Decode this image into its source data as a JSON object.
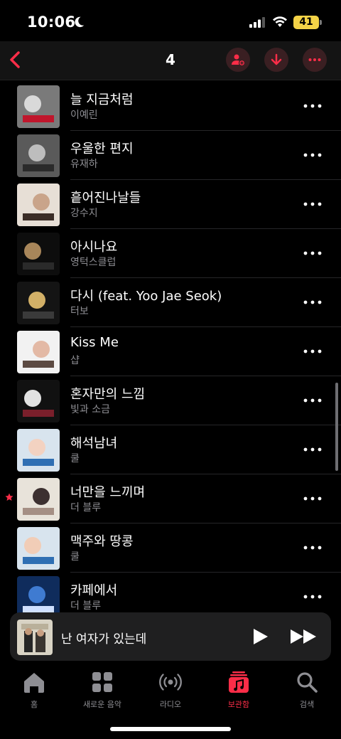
{
  "status_bar": {
    "time": "10:06",
    "battery": "41"
  },
  "nav": {
    "title": "4"
  },
  "songs": [
    {
      "title": "늘 지금처럼",
      "artist": "이예린",
      "favorite": false
    },
    {
      "title": "우울한 편지",
      "artist": "유재하",
      "favorite": false
    },
    {
      "title": "흩어진나날들",
      "artist": "강수지",
      "favorite": false
    },
    {
      "title": "아시나요",
      "artist": "영턱스클럽",
      "favorite": false
    },
    {
      "title": "다시 (feat. Yoo Jae Seok)",
      "artist": "터보",
      "favorite": false
    },
    {
      "title": "Kiss Me",
      "artist": "샵",
      "favorite": false
    },
    {
      "title": "혼자만의 느낌",
      "artist": "빛과 소금",
      "favorite": false
    },
    {
      "title": "해석남녀",
      "artist": "쿨",
      "favorite": false
    },
    {
      "title": "너만을 느끼며",
      "artist": "더 블루",
      "favorite": true
    },
    {
      "title": "맥주와 땅콩",
      "artist": "쿨",
      "favorite": false
    },
    {
      "title": "카페에서",
      "artist": "더 블루",
      "favorite": false
    }
  ],
  "now_playing": {
    "title": "난 여자가 있는데"
  },
  "tabs": [
    {
      "label": "홈",
      "icon": "home-icon",
      "active": false
    },
    {
      "label": "새로운 음악",
      "icon": "grid-icon",
      "active": false
    },
    {
      "label": "라디오",
      "icon": "radio-icon",
      "active": false
    },
    {
      "label": "보관함",
      "icon": "library-icon",
      "active": true
    },
    {
      "label": "검색",
      "icon": "search-icon",
      "active": false
    }
  ],
  "colors": {
    "accent": "#fa2d48",
    "background": "#000000",
    "secondary_text": "#8e8e93",
    "battery": "#f4d347"
  }
}
